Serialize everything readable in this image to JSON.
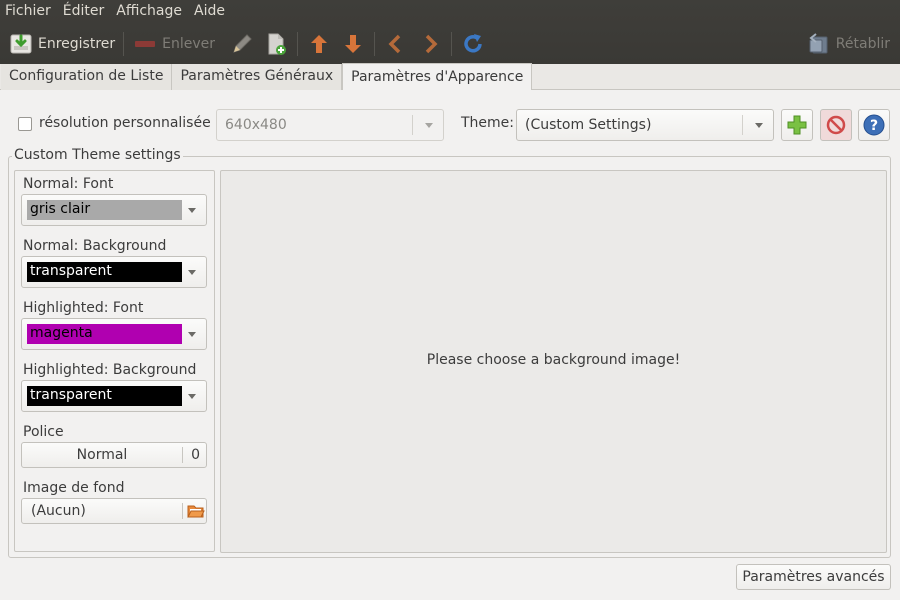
{
  "menu": [
    "Fichier",
    "Éditer",
    "Affichage",
    "Aide"
  ],
  "toolbar": {
    "save_label": "Enregistrer",
    "remove_label": "Enlever",
    "restore_label": "Rétablir"
  },
  "tabs": [
    {
      "label": "Configuration de Liste",
      "active": false
    },
    {
      "label": "Paramètres Généraux",
      "active": false
    },
    {
      "label": "Paramètres d'Apparence",
      "active": true
    }
  ],
  "appearance": {
    "resolution_label": "résolution personnalisée :",
    "resolution_value": "640x480",
    "theme_label": "Theme:",
    "theme_value": "(Custom Settings)",
    "frame_title": "Custom Theme settings",
    "normal_font_label": "Normal: Font",
    "normal_font_value": "gris clair",
    "normal_bg_label": "Normal: Background",
    "normal_bg_value": "transparent",
    "highlight_font_label": "Highlighted: Font",
    "highlight_font_value": "magenta",
    "highlight_bg_label": "Highlighted: Background",
    "highlight_bg_value": "transparent",
    "police_label": "Police",
    "police_font": "Normal",
    "police_size": "0",
    "bg_image_label": "Image de fond",
    "bg_image_value": "(Aucun)",
    "preview_message": "Please choose a background image!",
    "advanced_label": "Paramètres avancés"
  },
  "colors": {
    "gris_clair": "#a9a9a9",
    "transparent": "#000000",
    "magenta": "#b000b0",
    "toolbar_bg": "#3c3b37",
    "arrow_orange": "#d8753a",
    "refresh_blue": "#3b78c4"
  },
  "icons": {
    "save": "save-down-icon",
    "remove": "remove-bar-icon",
    "edit": "pencil-icon",
    "new": "new-document-icon",
    "up": "arrow-up-icon",
    "down": "arrow-down-icon",
    "prev": "chevron-left-icon",
    "next": "chevron-right-icon",
    "refresh": "refresh-icon",
    "restore": "restore-icon",
    "add": "plus-icon",
    "delete": "no-entry-icon",
    "help": "help-icon",
    "folder": "folder-open-icon"
  }
}
